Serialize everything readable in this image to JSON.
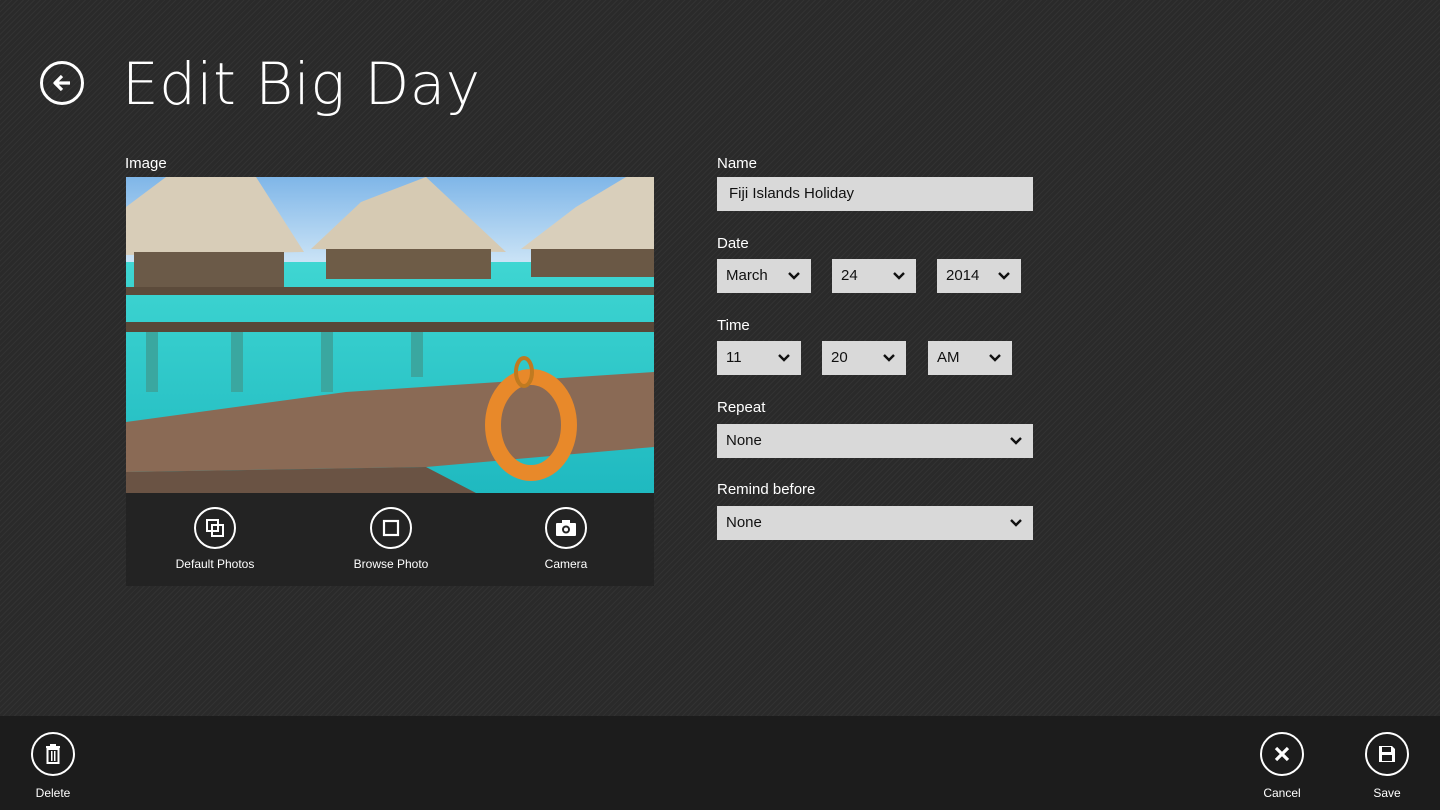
{
  "header": {
    "title": "Edit Big Day",
    "back_icon": "back-arrow-icon"
  },
  "image_section": {
    "label": "Image",
    "actions": [
      {
        "label": "Default Photos",
        "icon": "photos-icon"
      },
      {
        "label": "Browse Photo",
        "icon": "browse-icon"
      },
      {
        "label": "Camera",
        "icon": "camera-icon"
      }
    ]
  },
  "form": {
    "name": {
      "label": "Name",
      "value": "Fiji Islands Holiday"
    },
    "date": {
      "label": "Date",
      "month": "March",
      "day": "24",
      "year": "2014"
    },
    "time": {
      "label": "Time",
      "hour": "11",
      "minute": "20",
      "ampm": "AM"
    },
    "repeat": {
      "label": "Repeat",
      "value": "None"
    },
    "remind": {
      "label": "Remind before",
      "value": "None"
    }
  },
  "app_bar": {
    "delete_label": "Delete",
    "cancel_label": "Cancel",
    "save_label": "Save"
  },
  "colors": {
    "background": "#2a2a2a",
    "field": "#d9d9d9",
    "app_bar": "#1c1c1c"
  }
}
